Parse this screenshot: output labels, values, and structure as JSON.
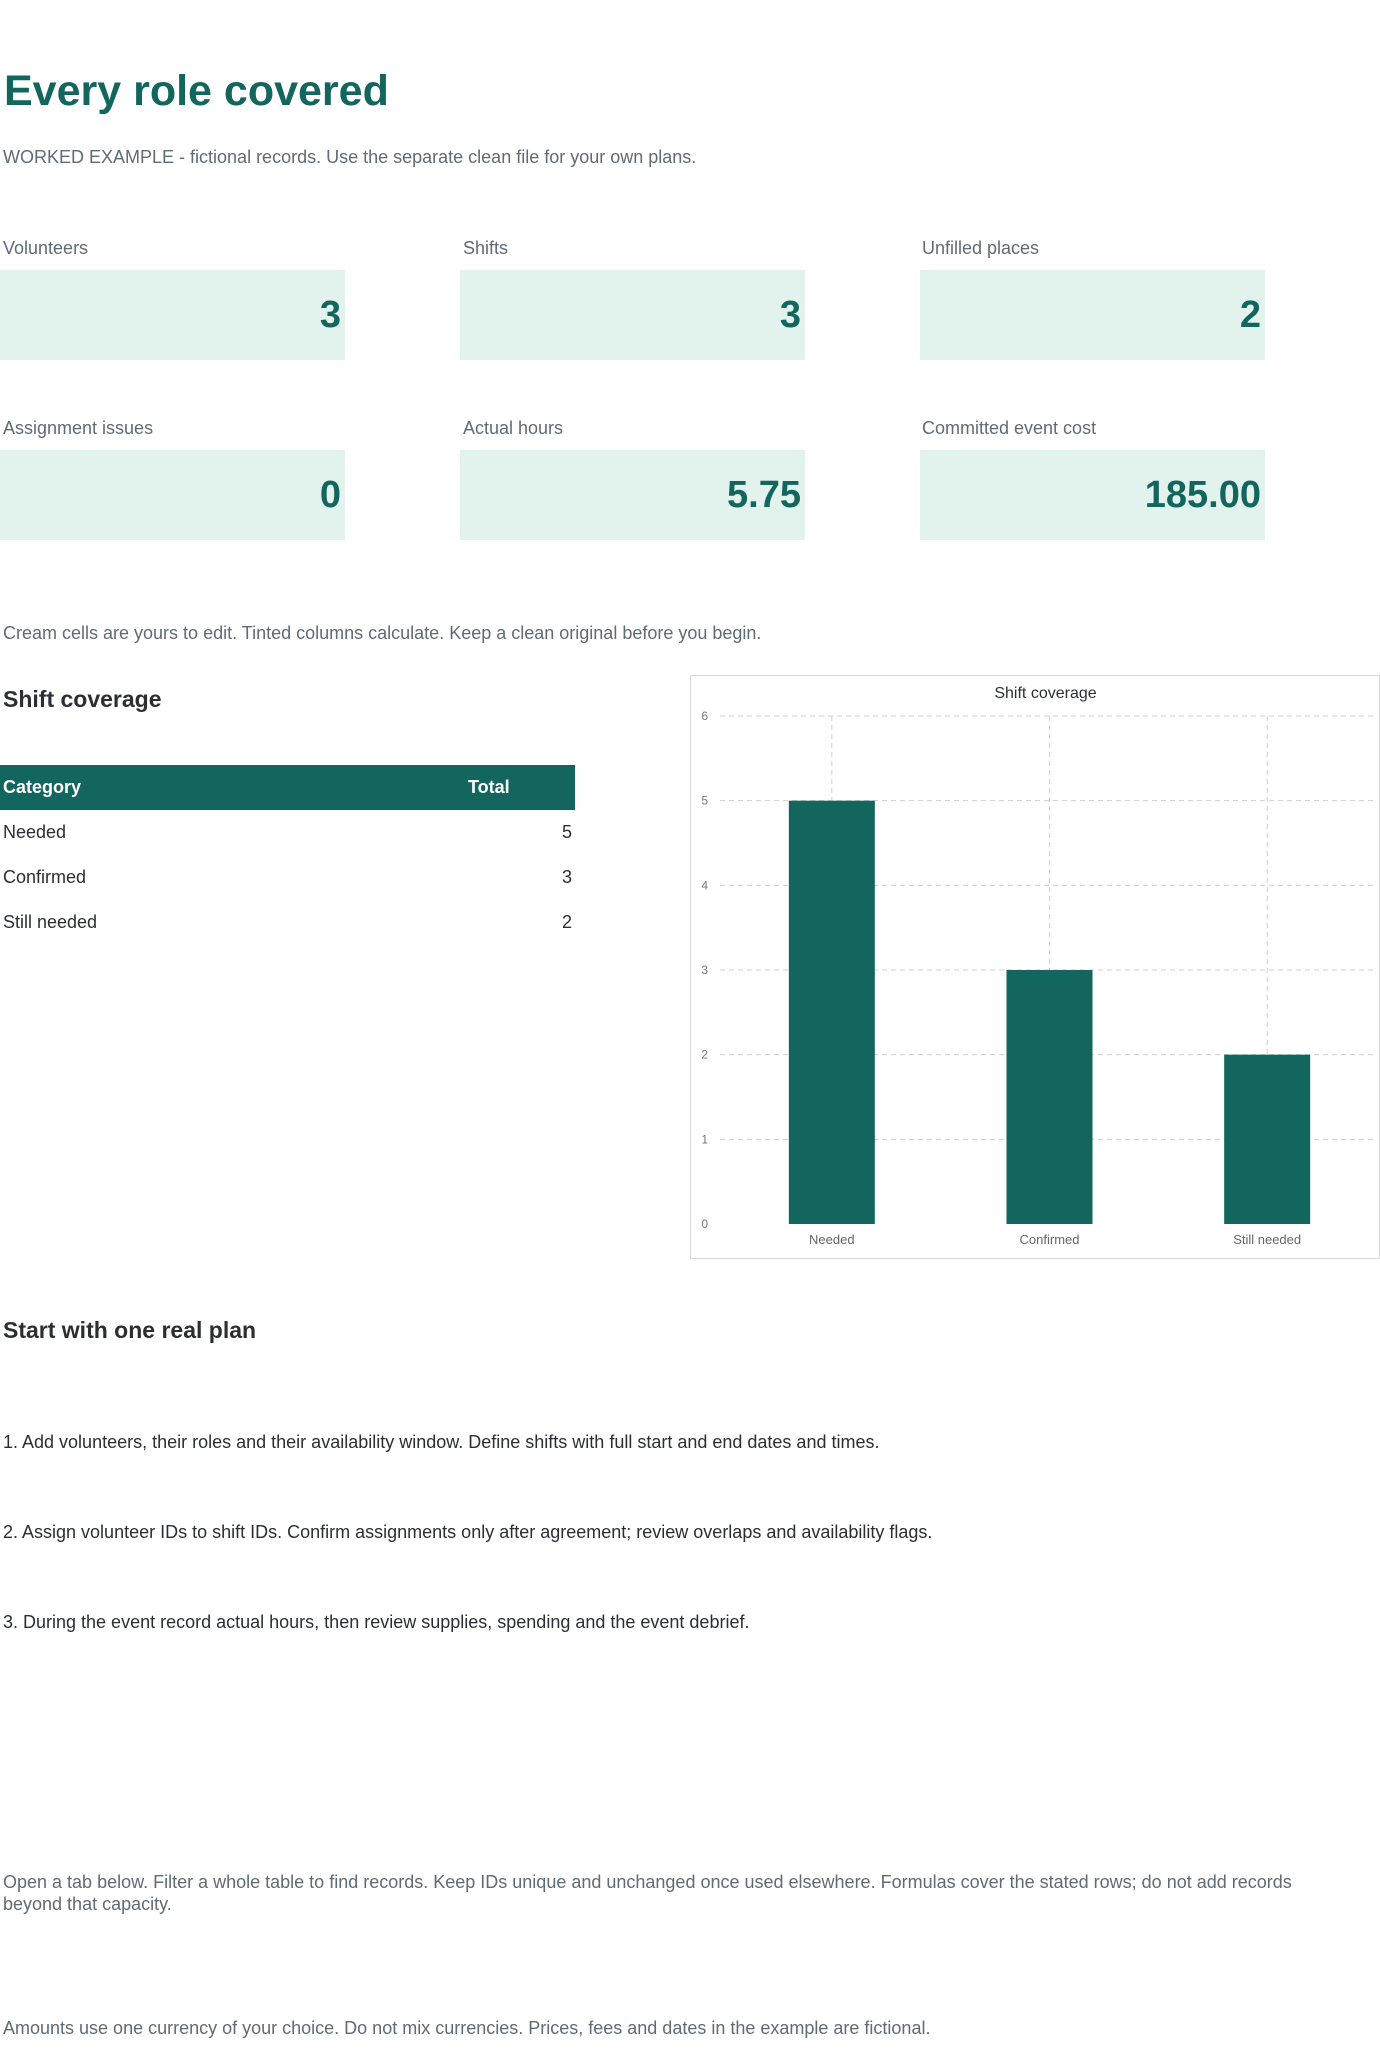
{
  "header": {
    "title": "Every role covered",
    "subtitle": "WORKED EXAMPLE - fictional records. Use the separate clean file for your own plans."
  },
  "kpis": [
    {
      "label": "Volunteers",
      "value": "3"
    },
    {
      "label": "Shifts",
      "value": "3"
    },
    {
      "label": "Unfilled places",
      "value": "2"
    },
    {
      "label": "Assignment issues",
      "value": "0"
    },
    {
      "label": "Actual hours",
      "value": "5.75"
    },
    {
      "label": "Committed event cost",
      "value": "185.00"
    }
  ],
  "edit_note": "Cream cells are yours to edit. Tinted columns calculate. Keep a clean original before you begin.",
  "coverage": {
    "title": "Shift coverage",
    "columns": [
      "Category",
      "Total"
    ],
    "rows": [
      {
        "category": "Needed",
        "total": "5"
      },
      {
        "category": "Confirmed",
        "total": "3"
      },
      {
        "category": "Still needed",
        "total": "2"
      }
    ]
  },
  "chart_data": {
    "type": "bar",
    "title": "Shift coverage",
    "categories": [
      "Needed",
      "Confirmed",
      "Still needed"
    ],
    "values": [
      5,
      3,
      2
    ],
    "xlabel": "",
    "ylabel": "",
    "ylim": [
      0,
      6
    ],
    "yticks": [
      0,
      1,
      2,
      3,
      4,
      5,
      6
    ],
    "grid": true,
    "legend": "none",
    "bar_color": "#13665e"
  },
  "plan": {
    "title": "Start with one real plan",
    "steps": [
      "1. Add volunteers, their roles and their availability window. Define shifts with full start and end dates and times.",
      "2. Assign volunteer IDs to shift IDs. Confirm assignments only after agreement; review overlaps and availability flags.",
      "3. During the event record actual hours, then review supplies, spending and the event debrief."
    ]
  },
  "footer_notes": [
    "Open a tab below. Filter a whole table to find records. Keep IDs unique and unchanged once used elsewhere. Formulas cover the stated rows; do not add records beyond that capacity.",
    "Amounts use one currency of your choice. Do not mix currencies. Prices, fees and dates in the example are fictional."
  ],
  "colors": {
    "accent": "#13665e",
    "kpi_fill": "#e2f2ec",
    "muted_text": "#5f6b75"
  }
}
